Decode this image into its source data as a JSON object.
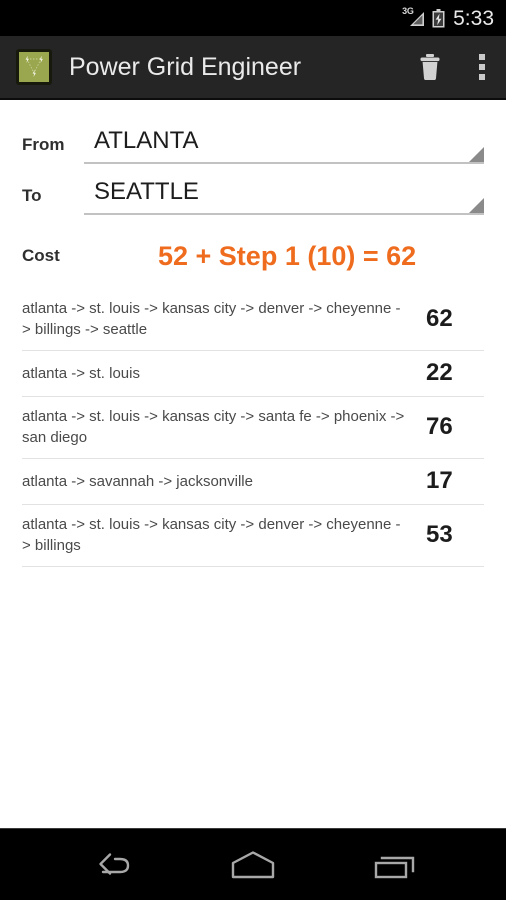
{
  "status_bar": {
    "network_label": "3G",
    "time": "5:33",
    "icons": {
      "signal": "signal-bars-icon",
      "battery": "battery-charging-icon"
    }
  },
  "action_bar": {
    "app_icon": "power-grid-app-icon",
    "title": "Power Grid Engineer",
    "icon_color": "#9aa74e",
    "actions": [
      {
        "name": "delete",
        "icon": "trash-icon",
        "label": "Delete"
      },
      {
        "name": "overflow",
        "icon": "overflow-menu-icon",
        "label": "More options"
      }
    ]
  },
  "form": {
    "from": {
      "label": "From",
      "value": "ATLANTA"
    },
    "to": {
      "label": "To",
      "value": "SEATTLE"
    },
    "cost": {
      "label": "Cost",
      "value": "52 + Step 1 (10) = 62",
      "color": "#ef6c1e"
    }
  },
  "results": [
    {
      "route": "atlanta -> st. louis -> kansas city -> denver -> cheyenne -> billings -> seattle",
      "cost": "62"
    },
    {
      "route": "atlanta -> st. louis",
      "cost": "22"
    },
    {
      "route": "atlanta -> st. louis -> kansas city -> santa fe -> phoenix -> san diego",
      "cost": "76"
    },
    {
      "route": "atlanta -> savannah -> jacksonville",
      "cost": "17"
    },
    {
      "route": "atlanta -> st. louis -> kansas city -> denver -> cheyenne -> billings",
      "cost": "53"
    }
  ],
  "nav_bar": {
    "buttons": [
      {
        "name": "back",
        "icon": "back-arrow-icon",
        "label": "Back"
      },
      {
        "name": "home",
        "icon": "home-icon",
        "label": "Home"
      },
      {
        "name": "recents",
        "icon": "recents-icon",
        "label": "Recent apps"
      }
    ]
  }
}
